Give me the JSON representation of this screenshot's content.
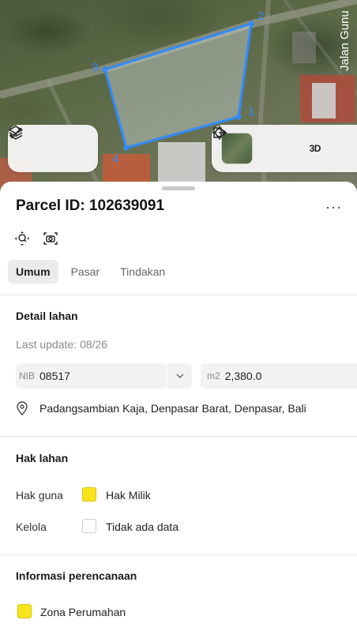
{
  "map": {
    "street_label": "Jalan Gunu",
    "vertices": [
      "1",
      "2",
      "3",
      "4"
    ],
    "polygon_color": "#1e90ff",
    "toolbar_left": [
      {
        "name": "layers-icon"
      },
      {
        "name": "measure-icon"
      }
    ],
    "toolbar_right": [
      {
        "name": "satellite-thumbnail"
      },
      {
        "name": "locate-icon"
      },
      {
        "name": "three-d-button",
        "label": "3D"
      },
      {
        "name": "export-icon"
      }
    ]
  },
  "parcel": {
    "title": "Parcel ID: 102639091",
    "more_label": "···"
  },
  "tabs": [
    "Umum",
    "Pasar",
    "Tindakan"
  ],
  "active_tab": "Umum",
  "detail": {
    "heading": "Detail lahan",
    "last_update": "Last update: 08/26",
    "nib_prefix": "NIB",
    "nib_value": "08517",
    "area_prefix": "m2",
    "area_value": "2,380.0",
    "address": "Padangsambian Kaja, Denpasar Barat, Denpasar, Bali"
  },
  "hak": {
    "heading": "Hak lahan",
    "rows": [
      {
        "label": "Hak guna",
        "value": "Hak Milik",
        "swatch_color": "#f8e41c"
      },
      {
        "label": "Kelola",
        "value": "Tidak ada data",
        "swatch_color": "#ffffff"
      }
    ]
  },
  "planning": {
    "heading": "Informasi perencanaan",
    "zone": "Zona Perumahan",
    "zone_color": "#f8e41c"
  },
  "colors": {
    "accent_yellow": "#f8e41c",
    "tab_active_bg": "#ebebeb"
  }
}
